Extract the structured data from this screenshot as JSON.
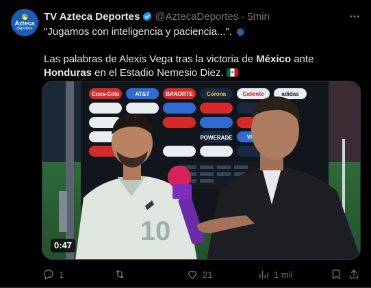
{
  "author": {
    "name": "TV Azteca Deportes",
    "handle": "@AztecaDeportes",
    "separator": "·",
    "time": "5min",
    "avatar_line1": "Azteca",
    "avatar_line2": "deportes"
  },
  "text": {
    "line1": "\"Jugamos con inteligencia y paciencia...\".",
    "line2_a": "Las palabras de Alexis Vega tras la victoria de ",
    "line2_b": "México",
    "line2_c": " ante ",
    "line2_d": "Honduras",
    "line2_e": " en el Estadio Nemesio Diez."
  },
  "media": {
    "duration": "0:47",
    "jersey_number": "10",
    "board_sponsors": [
      "Coca-Cola",
      "AT&T",
      "BANORTE",
      "Corona",
      "Caliente",
      "adidas",
      "POWERADE",
      "VISA"
    ]
  },
  "actions": {
    "replies": "1",
    "reposts": "",
    "likes": "21",
    "views": "1 mil"
  },
  "colors": {
    "background": "#000000",
    "text": "#e7e9ea",
    "secondary": "#71767b",
    "verified": "#1d9bf0"
  }
}
